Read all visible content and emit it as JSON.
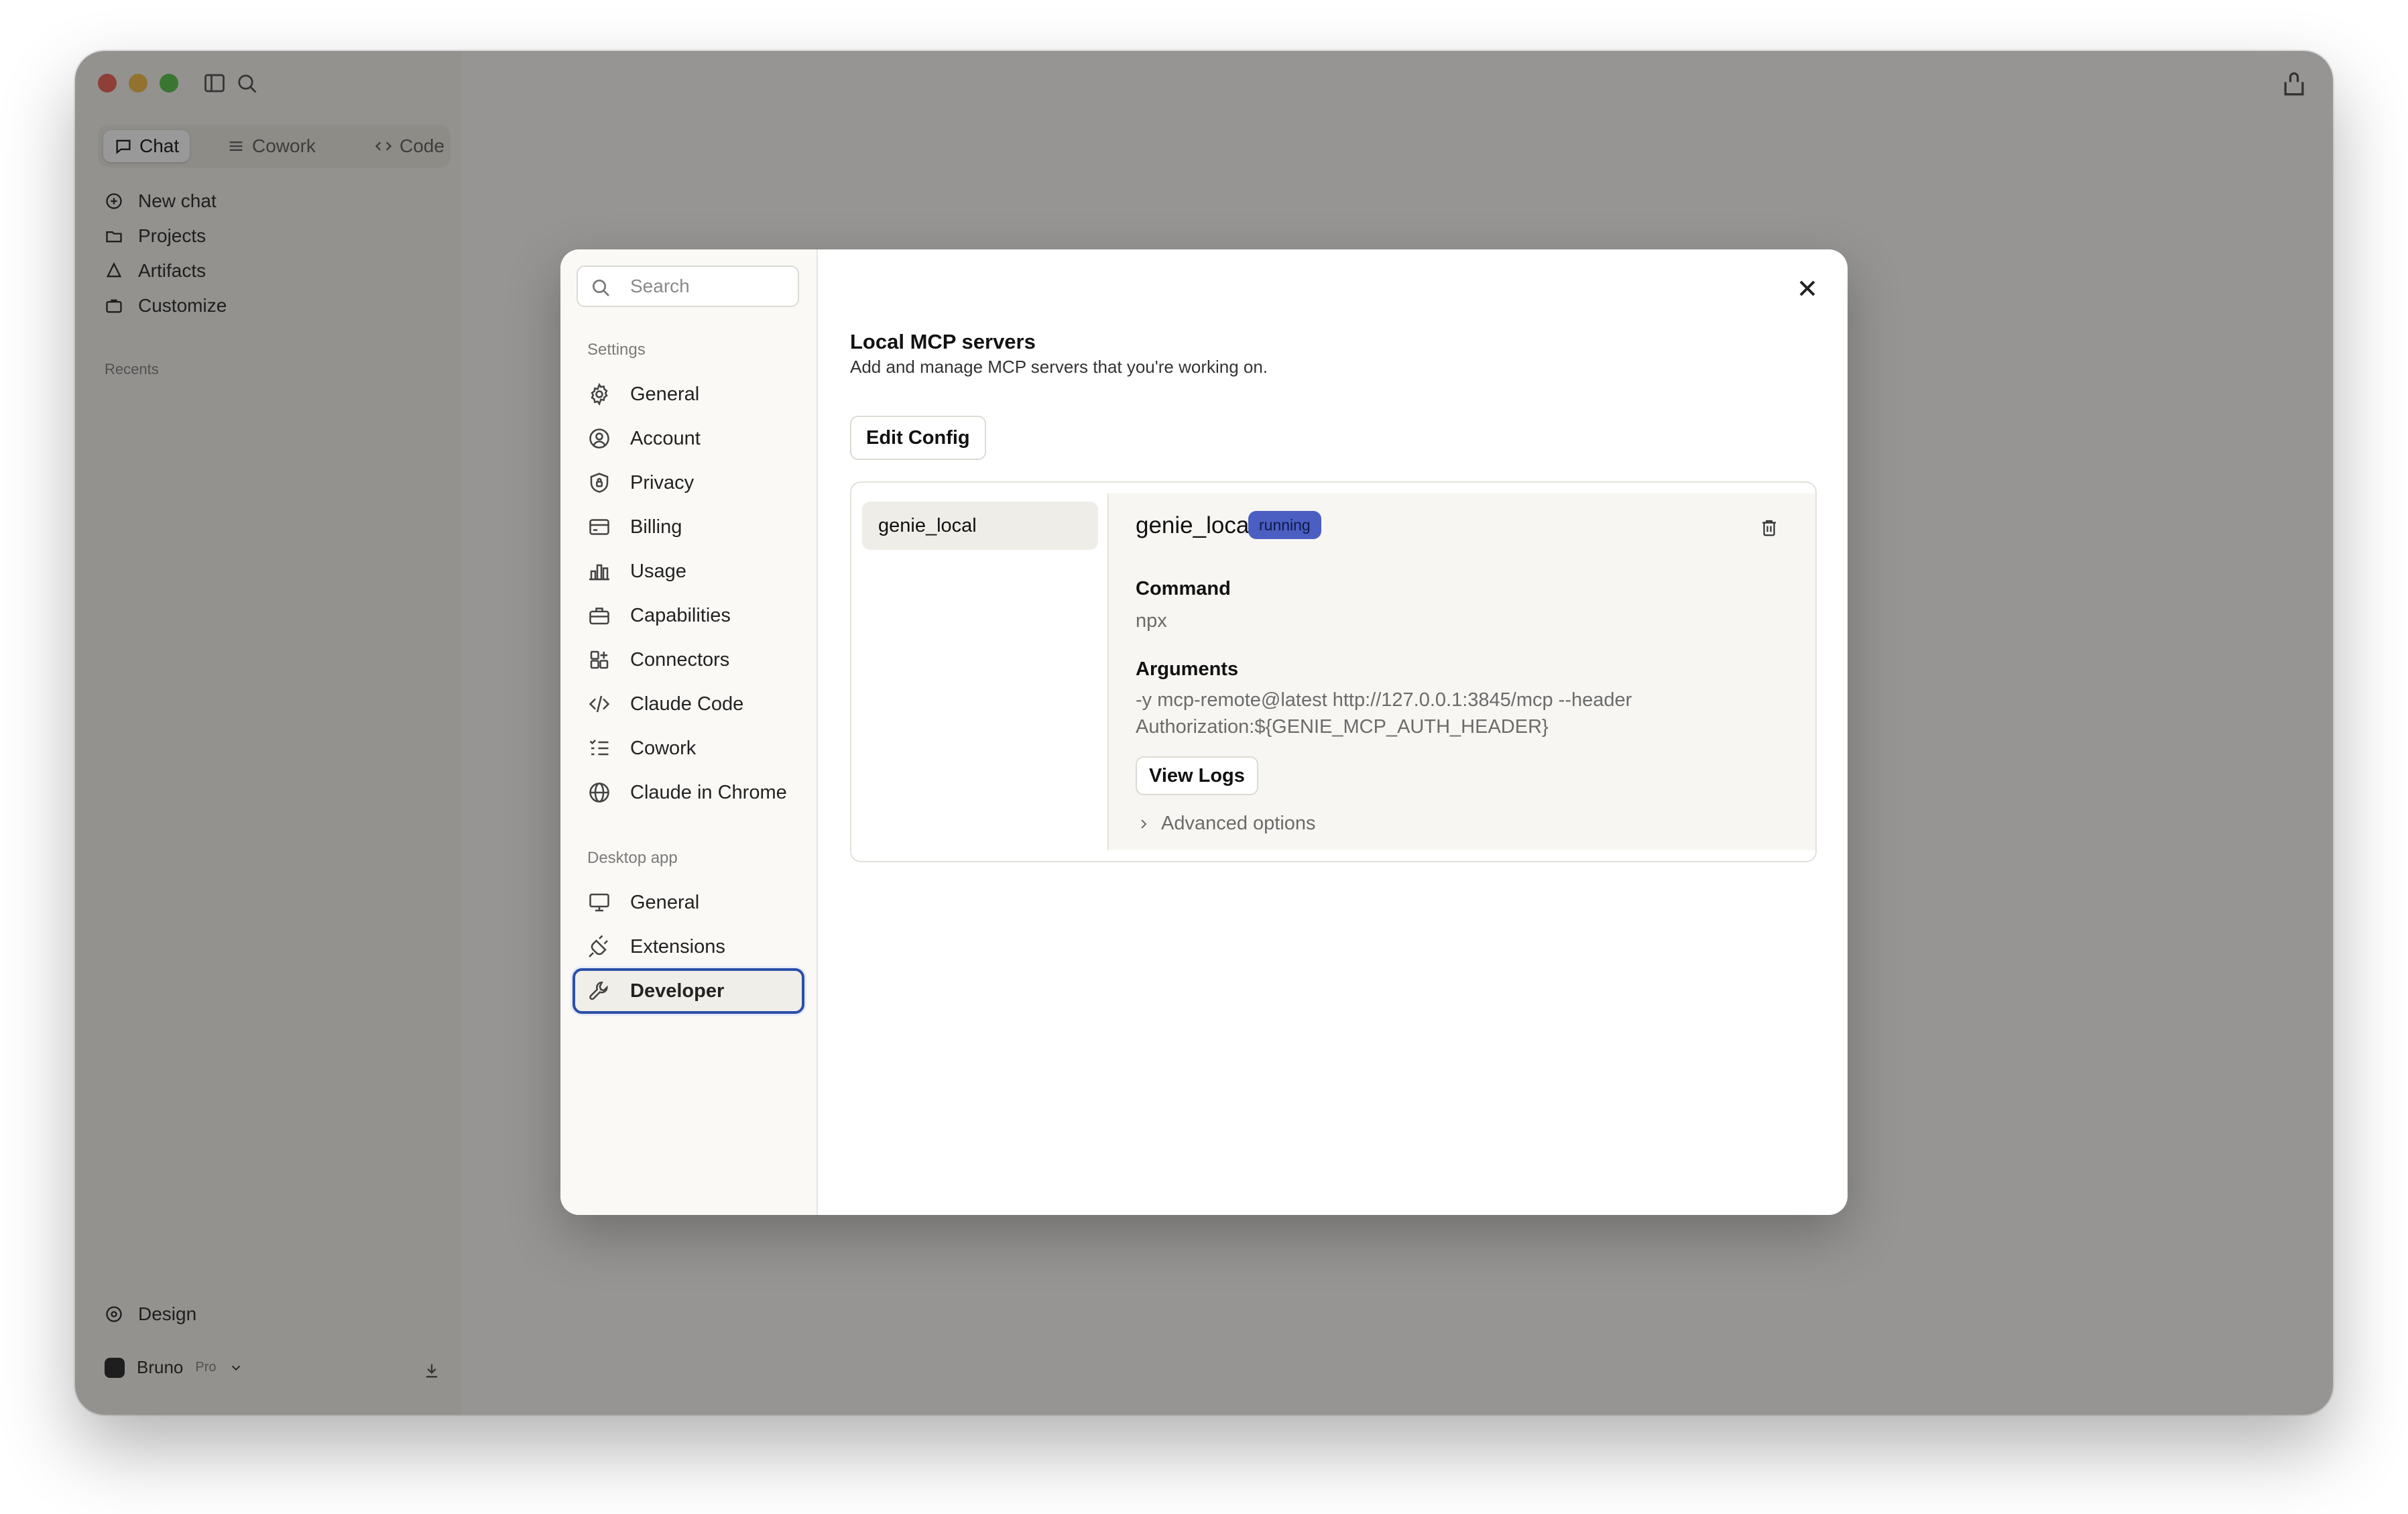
{
  "app": {
    "modes": [
      "Chat",
      "Cowork",
      "Code"
    ],
    "sidebar_items": [
      "New chat",
      "Projects",
      "Artifacts",
      "Customize"
    ],
    "recents_label": "Recents",
    "footer_item": "Design",
    "user_name": "Bruno",
    "user_plan": "Pro"
  },
  "settings": {
    "search_placeholder": "Search",
    "settings_section": "Settings",
    "settings_items": [
      "General",
      "Account",
      "Privacy",
      "Billing",
      "Usage",
      "Capabilities",
      "Connectors",
      "Claude Code",
      "Cowork",
      "Claude in Chrome"
    ],
    "desktop_section": "Desktop app",
    "desktop_items": [
      "General",
      "Extensions",
      "Developer"
    ],
    "active_item": "Developer"
  },
  "developer": {
    "title": "Local MCP servers",
    "subtitle": "Add and manage MCP servers that you're working on.",
    "edit_config_label": "Edit Config",
    "servers": [
      "genie_local"
    ],
    "selected": {
      "name": "genie_local",
      "status": "running",
      "command_label": "Command",
      "command": "npx",
      "arguments_label": "Arguments",
      "arguments_line1": "-y mcp-remote@latest http://127.0.0.1:3845/mcp --header",
      "arguments_line2": "Authorization:${GENIE_MCP_AUTH_HEADER}",
      "view_logs_label": "View Logs",
      "advanced_label": "Advanced options"
    }
  },
  "colors": {
    "accent": "#2b4fa8",
    "badge": "#4a5fc1"
  }
}
